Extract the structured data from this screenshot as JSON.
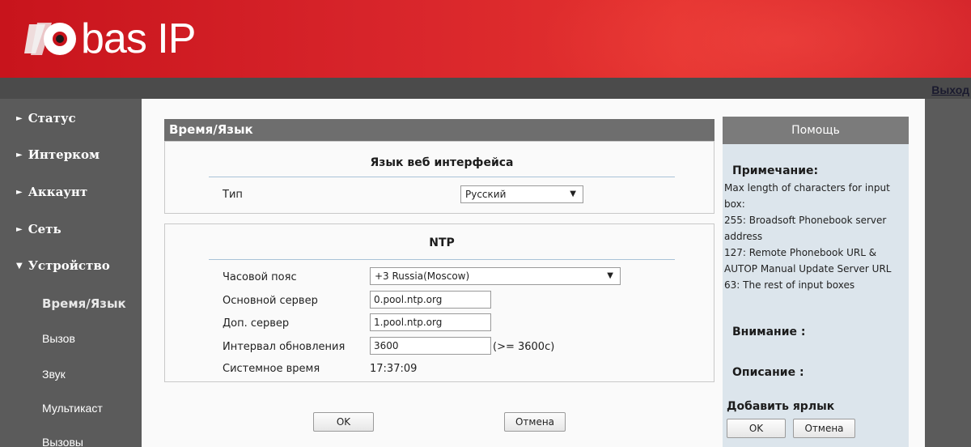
{
  "brand": {
    "name": "bas IP"
  },
  "header": {
    "logout_label": "Выход"
  },
  "sidebar": {
    "items": [
      {
        "label": "Статус",
        "arrow": "►"
      },
      {
        "label": "Интерком",
        "arrow": "►"
      },
      {
        "label": "Аккаунт",
        "arrow": "►"
      },
      {
        "label": "Сеть",
        "arrow": "►"
      },
      {
        "label": "Устройство",
        "arrow": "▼"
      }
    ],
    "sub_items": [
      {
        "label": "Время/Язык"
      },
      {
        "label": "Вызов"
      },
      {
        "label": "Звук"
      },
      {
        "label": "Мультикаст"
      },
      {
        "label": "Вызовы"
      }
    ]
  },
  "main": {
    "title": "Время/Язык",
    "language": {
      "title": "Язык веб интерфейса",
      "type_label": "Тип",
      "type_value": "Русский"
    },
    "ntp": {
      "title": "NTP",
      "timezone_label": "Часовой пояс",
      "timezone_value": "+3 Russia(Moscow)",
      "primary_server_label": "Основной сервер",
      "primary_server_value": "0.pool.ntp.org",
      "secondary_server_label": "Доп. сервер",
      "secondary_server_value": "1.pool.ntp.org",
      "interval_label": "Интервал обновления",
      "interval_value": "3600",
      "interval_hint": "(>= 3600с)",
      "system_time_label": "Системное время",
      "system_time_value": "17:37:09"
    },
    "ok_label": "OK",
    "cancel_label": "Отмена"
  },
  "help": {
    "header": "Помощь",
    "note_title": "Примечание:",
    "note_lines": [
      "Max length of characters for input",
      "box:",
      "255: Broadsoft Phonebook server",
      "address",
      "127: Remote Phonebook URL &",
      "AUTOP Manual Update Server URL",
      "63: The rest of input boxes"
    ],
    "attention_title": "Внимание :",
    "description_title": "Описание :",
    "shortcut_title": "Добавить ярлык",
    "ok_label": "OK",
    "cancel_label": "Отмена"
  },
  "icons": {
    "select_arrow": "▼"
  }
}
